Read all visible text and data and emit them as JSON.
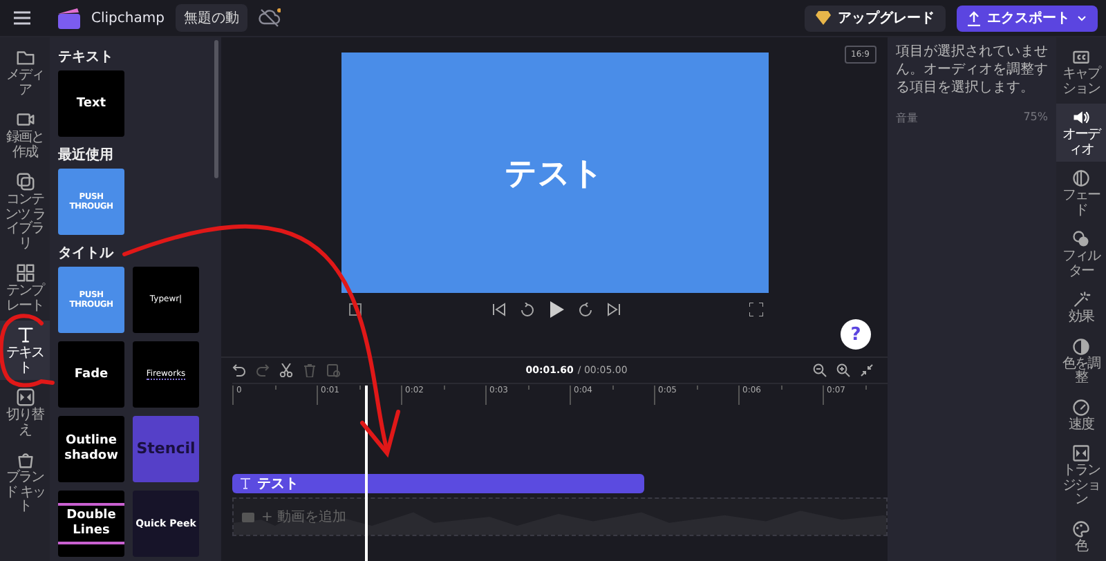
{
  "top_bar": {
    "app_name": "Clipchamp",
    "project_title": "無題の動",
    "upgrade_button": "アップグレード",
    "export_button": "エクスポート"
  },
  "nav_rail": [
    {
      "label": "メディア",
      "selected": false
    },
    {
      "label": "録画と作成",
      "selected": false
    },
    {
      "label": "コンテンツ ライブラリ",
      "selected": false
    },
    {
      "label": "テンプレート",
      "selected": false
    },
    {
      "label": "テキスト",
      "selected": true
    },
    {
      "label": "切り替え",
      "selected": false
    },
    {
      "label": "ブランド キット",
      "selected": false
    }
  ],
  "panel": {
    "sections": [
      {
        "heading": "テキスト",
        "tiles": [
          {
            "label": "Text",
            "kind": "plain"
          }
        ]
      },
      {
        "heading": "最近使用",
        "tiles": [
          {
            "label": "PUSH THROUGH",
            "kind": "blue"
          }
        ]
      },
      {
        "heading": "タイトル",
        "tiles": [
          {
            "label": "PUSH THROUGH",
            "kind": "blue"
          },
          {
            "label": "Typewr|",
            "kind": "typewriter"
          },
          {
            "label": "Fade",
            "kind": "plain"
          },
          {
            "label": "Fireworks",
            "kind": "fireworks"
          },
          {
            "label": "Outline shadow",
            "kind": "plain"
          },
          {
            "label": "Stencil",
            "kind": "purple"
          },
          {
            "label": "Double Lines",
            "kind": "double-lines"
          },
          {
            "label": "Quick Peek",
            "kind": "dots"
          }
        ]
      }
    ]
  },
  "preview": {
    "aspect_button": "16:9",
    "canvas_text": "テスト",
    "help_button": "?"
  },
  "properties": {
    "message": "項目が選択されていません。オーディオを調整する項目を選択します。",
    "volume_label": "音量",
    "volume_value": "75%"
  },
  "tool_rail": [
    {
      "label": "キャプション",
      "selected": false
    },
    {
      "label": "オーディオ",
      "selected": true
    },
    {
      "label": "フェード",
      "selected": false
    },
    {
      "label": "フィルター",
      "selected": false
    },
    {
      "label": "効果",
      "selected": false
    },
    {
      "label": "色を調整",
      "selected": false
    },
    {
      "label": "速度",
      "selected": false
    },
    {
      "label": "トランジション",
      "selected": false
    },
    {
      "label": "色",
      "selected": false
    }
  ],
  "timeline": {
    "current_time": "00:01.60",
    "total_time": "/ 00:05.00",
    "ruler": [
      "0",
      "0:01",
      "0:02",
      "0:03",
      "0:04",
      "0:05",
      "0:06",
      "0:07"
    ],
    "text_clip": "テスト",
    "media_placeholder": "+ 動画を追加"
  }
}
